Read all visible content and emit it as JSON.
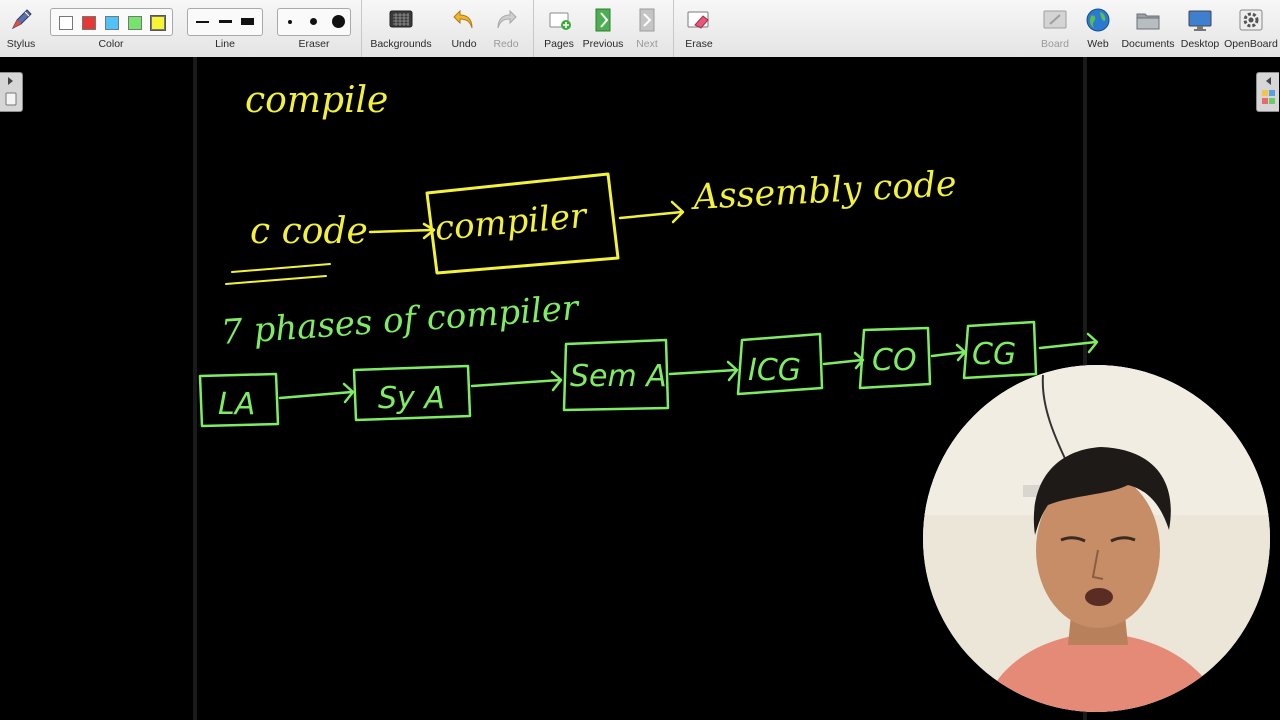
{
  "app": "OpenBoard",
  "toolbar": {
    "stylus": "Stylus",
    "color": "Color",
    "line": "Line",
    "eraser": "Eraser",
    "backgrounds": "Backgrounds",
    "undo": "Undo",
    "redo": "Redo",
    "pages": "Pages",
    "previous": "Previous",
    "next": "Next",
    "erase": "Erase",
    "board": "Board",
    "web": "Web",
    "documents": "Documents",
    "desktop": "Desktop",
    "openboard": "OpenBoard"
  },
  "palette": [
    "#ffffff",
    "#e53935",
    "#4fc3f7",
    "#76e36a",
    "#f5f531"
  ],
  "selected_color": "#f5f531",
  "board": {
    "ink_yellow": "#f3f23b",
    "ink_green": "#7fec64",
    "word_compile": "compile",
    "c_code": "c code",
    "compiler_box": "compiler",
    "assembly_code": "Assembly code",
    "phases_heading": "7 phases of compiler",
    "phases": [
      "LA",
      "Sy A",
      "Sem A",
      "ICG",
      "CO",
      "CG"
    ]
  }
}
